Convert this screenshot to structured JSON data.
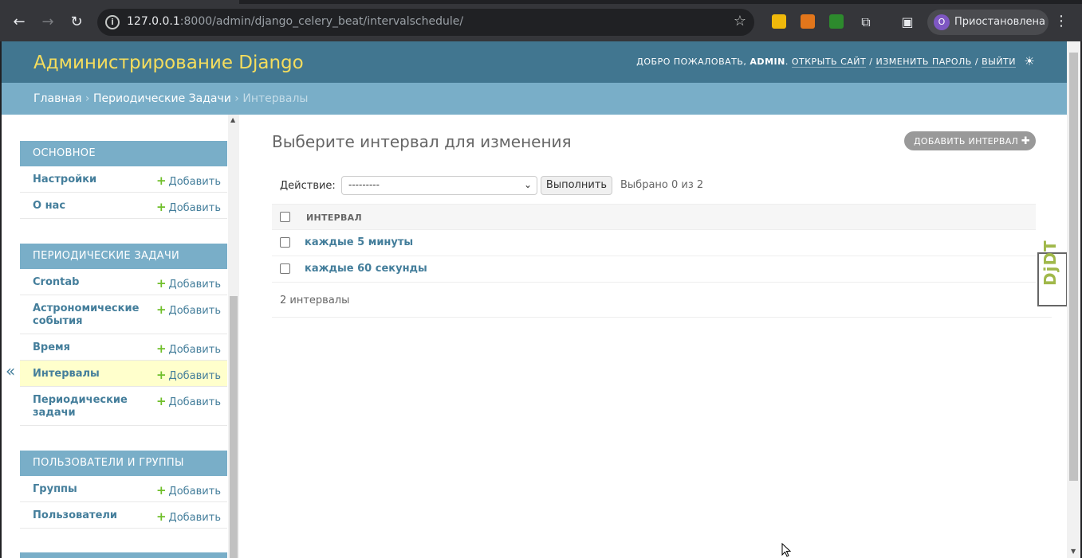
{
  "browser": {
    "url_host": "127.0.0.1",
    "url_rest": ":8000/admin/django_celery_beat/intervalschedule/",
    "profile_initial": "О",
    "profile_label": "Приостановлена",
    "icons": [
      "back-icon",
      "forward-icon",
      "reload-icon",
      "site-info-icon",
      "bookmark-star-icon",
      "extensions-icon",
      "side-panel-icon",
      "kebab-menu-icon"
    ]
  },
  "header": {
    "brand": "Администрирование Django",
    "welcome": "ДОБРО ПОЖАЛОВАТЬ, ",
    "user": "ADMIN",
    "view_site": "ОТКРЫТЬ САЙТ",
    "change_password": "ИЗМЕНИТЬ ПАРОЛЬ",
    "logout": "ВЫЙТИ",
    "sep": " / "
  },
  "breadcrumbs": {
    "home": "Главная",
    "app": "Периодические Задачи",
    "current": "Интервалы",
    "sep": " › "
  },
  "sidebar": {
    "toggle": "«",
    "add_label": "Добавить",
    "modules": [
      {
        "caption": "ОСНОВНОЕ",
        "items": [
          "Настройки",
          "О нас"
        ]
      },
      {
        "caption": "ПЕРИОДИЧЕСКИЕ ЗАДАЧИ",
        "items": [
          "Crontab",
          "Астрономические события",
          "Время",
          "Интервалы",
          "Периодические задачи"
        ]
      },
      {
        "caption": "ПОЛЬЗОВАТЕЛИ И ГРУППЫ",
        "items": [
          "Группы",
          "Пользователи"
        ]
      }
    ],
    "selected": "Интервалы"
  },
  "content": {
    "title": "Выберите интервал для изменения",
    "add_button": "ДОБАВИТЬ ИНТЕРВАЛ",
    "action_label": "Действие:",
    "action_value": "---------",
    "go_button": "Выполнить",
    "selected_count": "Выбрано 0 из 2",
    "column_header": "ИНТЕРВАЛ",
    "rows": [
      "каждые 5 минуты",
      "каждые 60 секунды"
    ],
    "paginator": "2 интервалы"
  },
  "djdt": "DjDT",
  "colors": {
    "header_bg": "#417690",
    "brand": "#f5dd5d",
    "breadcrumbs_bg": "#79aec8",
    "link": "#447e9b",
    "selected_row": "#ffffcc",
    "add_plus": "#70bf2b"
  }
}
